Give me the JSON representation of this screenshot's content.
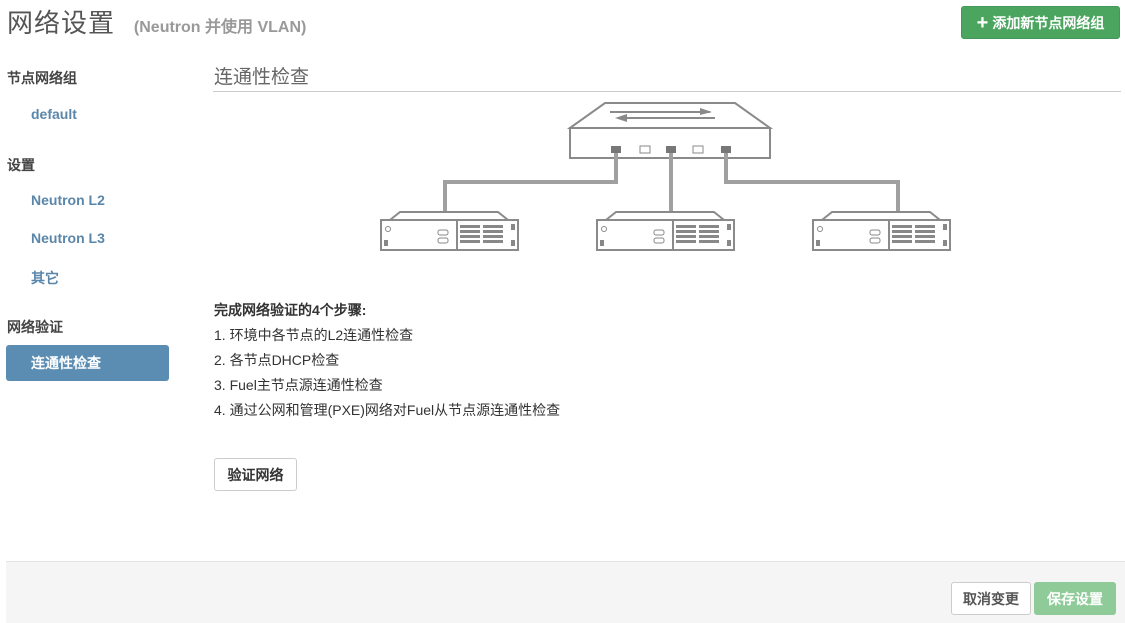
{
  "header": {
    "title": "网络设置",
    "subtitle": "(Neutron 并使用 VLAN)",
    "add_group_label": "添加新节点网络组"
  },
  "sidebar": {
    "groups_heading": "节点网络组",
    "groups_items": [
      {
        "label": "default"
      }
    ],
    "settings_heading": "设置",
    "settings_items": [
      {
        "label": "Neutron L2"
      },
      {
        "label": "Neutron L3"
      },
      {
        "label": "其它"
      }
    ],
    "verify_heading": "网络验证",
    "verify_items": [
      {
        "label": "连通性检查",
        "active": true
      }
    ]
  },
  "main": {
    "section_title": "连通性检查",
    "steps_title": "完成网络验证的4个步骤:",
    "steps": [
      "1. 环境中各节点的L2连通性检查",
      "2. 各节点DHCP检查",
      "3. Fuel主节点源连通性检查",
      "4. 通过公网和管理(PXE)网络对Fuel从节点源连通性检查"
    ],
    "verify_button": "验证网络"
  },
  "footer": {
    "cancel_label": "取消变更",
    "save_label": "保存设置"
  },
  "colors": {
    "accent_green": "#4ba55f",
    "save_disabled_green": "#8fcb99",
    "active_blue": "#5b8db3",
    "link_blue": "#5a86aa"
  },
  "icons": {
    "add": "plus-icon",
    "diagram": "network-switch-diagram"
  }
}
